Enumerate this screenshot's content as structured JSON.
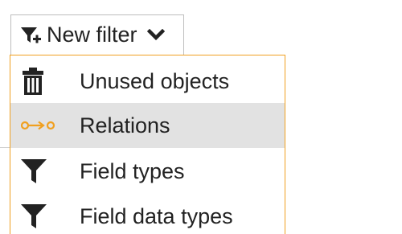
{
  "filter_button": {
    "label": "New filter",
    "icon": "funnel-plus-icon",
    "dropdown_icon": "chevron-down-icon"
  },
  "menu": {
    "accent_color": "#f0a020",
    "items": [
      {
        "label": "Unused objects",
        "icon": "trash-icon",
        "highlighted": false
      },
      {
        "label": "Relations",
        "icon": "relations-icon",
        "highlighted": true
      },
      {
        "label": "Field types",
        "icon": "funnel-icon",
        "highlighted": false
      },
      {
        "label": "Field data types",
        "icon": "funnel-icon",
        "highlighted": false
      }
    ]
  }
}
